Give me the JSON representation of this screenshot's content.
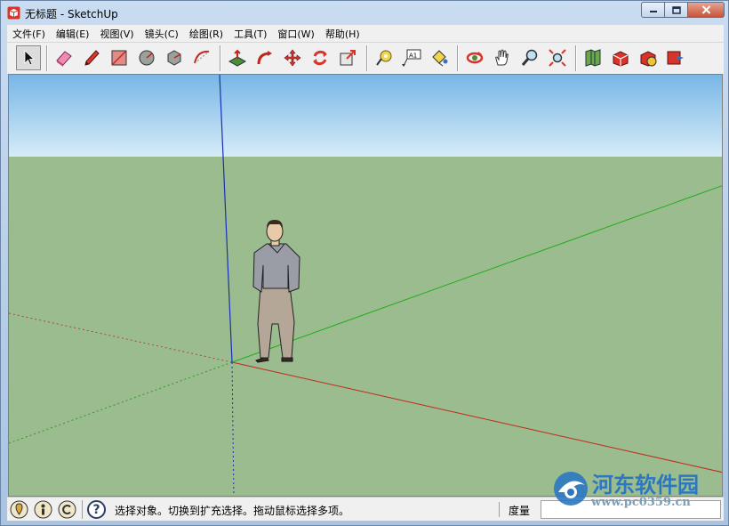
{
  "window": {
    "title": "无标题 - SketchUp",
    "caption_buttons": [
      "minimize-icon",
      "maximize-icon",
      "close-icon"
    ]
  },
  "menu": {
    "items": [
      "文件(F)",
      "编辑(E)",
      "视图(V)",
      "镜头(C)",
      "绘图(R)",
      "工具(T)",
      "窗口(W)",
      "帮助(H)"
    ]
  },
  "toolbar": {
    "tools": [
      {
        "name": "select-tool",
        "icon": "arrow-cursor-icon",
        "active": true
      },
      {
        "name": "eraser-tool",
        "icon": "eraser-icon"
      },
      {
        "name": "pencil-tool",
        "icon": "pencil-icon"
      },
      {
        "name": "rectangle-tool",
        "icon": "rectangle-icon"
      },
      {
        "name": "circle-tool",
        "icon": "circle-icon"
      },
      {
        "name": "polygon-tool",
        "icon": "polygon-icon"
      },
      {
        "name": "arc-tool",
        "icon": "arc-icon"
      },
      {
        "name": "push-pull-tool",
        "icon": "push-pull-icon"
      },
      {
        "name": "follow-me-tool",
        "icon": "follow-me-icon"
      },
      {
        "name": "move-tool",
        "icon": "move-arrows-icon"
      },
      {
        "name": "rotate-tool",
        "icon": "rotate-icon"
      },
      {
        "name": "scale-tool",
        "icon": "scale-icon"
      },
      {
        "name": "tape-measure-tool",
        "icon": "tape-measure-icon"
      },
      {
        "name": "text-tool",
        "icon": "text-label-icon"
      },
      {
        "name": "paint-bucket-tool",
        "icon": "paint-bucket-icon"
      },
      {
        "name": "orbit-tool",
        "icon": "orbit-icon"
      },
      {
        "name": "pan-tool",
        "icon": "hand-icon"
      },
      {
        "name": "zoom-tool",
        "icon": "magnifier-icon"
      },
      {
        "name": "zoom-extents-tool",
        "icon": "zoom-extents-icon"
      },
      {
        "name": "geo-location-tool",
        "icon": "map-icon"
      },
      {
        "name": "3d-warehouse-tool",
        "icon": "warehouse-icon"
      },
      {
        "name": "share-model-tool",
        "icon": "share-model-icon"
      },
      {
        "name": "extension-warehouse-tool",
        "icon": "extension-icon"
      }
    ],
    "text_tool_label": "A1"
  },
  "status": {
    "icons": [
      "geo-location-icon",
      "credits-icon",
      "copyright-icon",
      "help-icon"
    ],
    "help_glyph": "?",
    "message": "选择对象。切换到扩充选择。拖动鼠标选择多项。",
    "measure_label": "度量",
    "measure_value": ""
  },
  "watermark": {
    "title": "河东软件园",
    "url": "www.pc0359.cn"
  },
  "colors": {
    "sky_top": "#78b6e6",
    "sky_bottom": "#d6ecf8",
    "ground": "#9bbc8f",
    "axis_red": "#c0281e",
    "axis_green": "#1fae1f",
    "axis_blue": "#1a2fb5"
  }
}
